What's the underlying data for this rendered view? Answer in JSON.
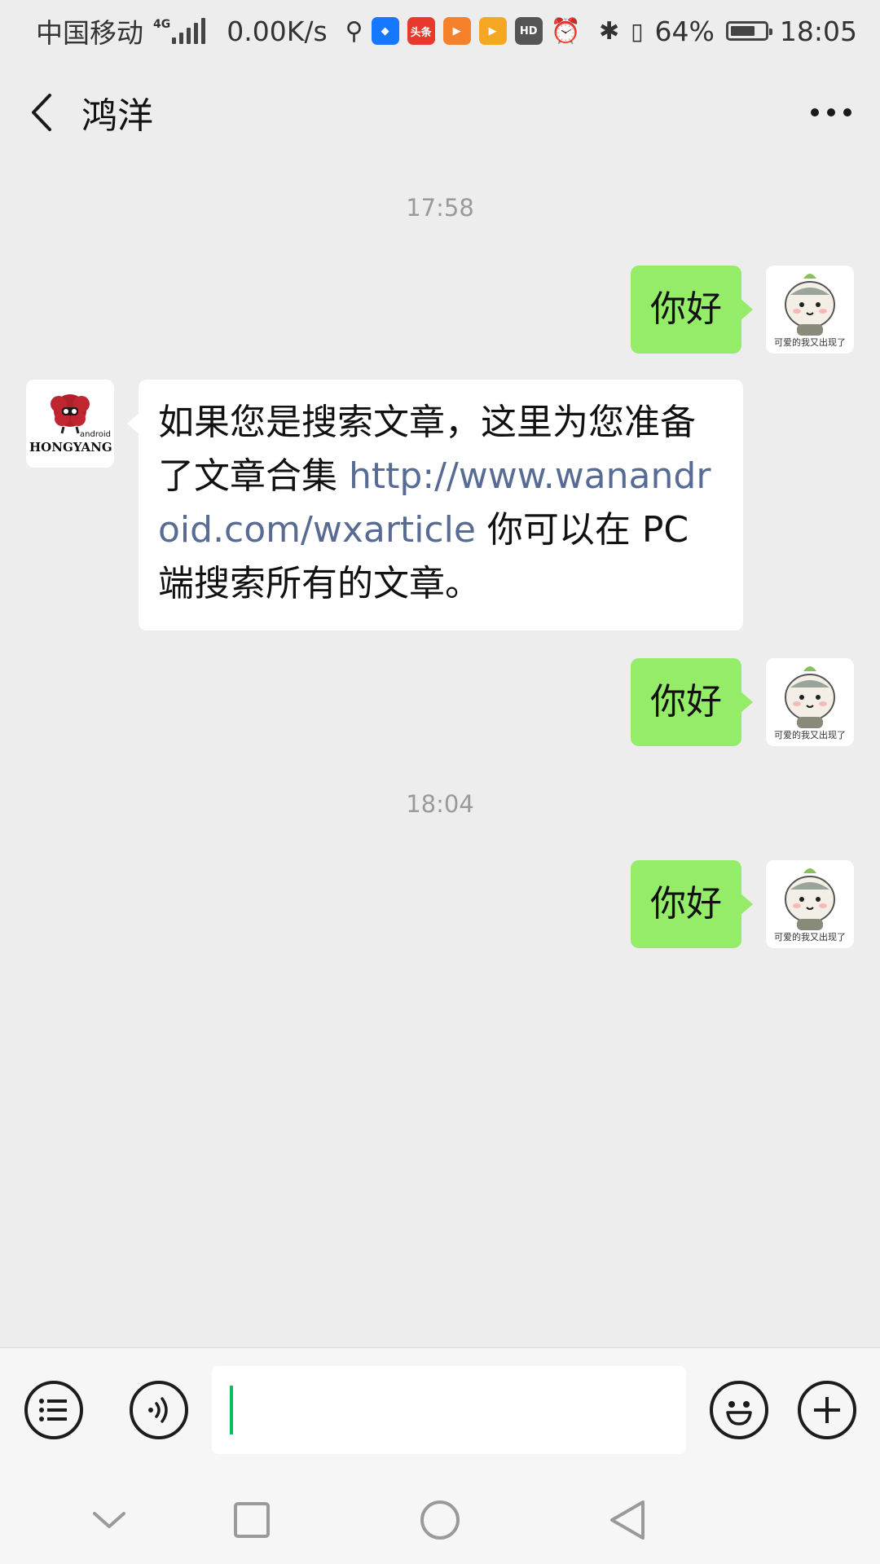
{
  "status_bar": {
    "carrier": "中国移动",
    "network": "4G",
    "speed": "0.00K/s",
    "app_icons": [
      {
        "name": "usb-icon"
      },
      {
        "name": "shield-app-icon",
        "color": "#1677ff"
      },
      {
        "name": "toutiao-app-icon",
        "label": "头条",
        "color": "#e8392f"
      },
      {
        "name": "play-app-icon",
        "color": "#f5822a"
      },
      {
        "name": "video-app-icon",
        "color": "#f5a623"
      },
      {
        "name": "hd-icon",
        "label": "HD"
      },
      {
        "name": "alarm-icon"
      },
      {
        "name": "bluetooth-icon"
      },
      {
        "name": "vibrate-icon"
      }
    ],
    "battery_percent_text": "64%",
    "battery_level": 0.64,
    "time": "18:05"
  },
  "header": {
    "back_icon": "chevron-left-icon",
    "title": "鸿洋",
    "more_icon": "more-dots-icon"
  },
  "messages": [
    {
      "type": "timestamp",
      "text": "17:58"
    },
    {
      "type": "outgoing",
      "text": "你好"
    },
    {
      "type": "incoming",
      "text_parts": [
        "如果您是搜索文章，这里为您准备了文章合集 ",
        "http://www.wanandroid.com/wxarticle",
        " 你可以在 PC 端搜索所有的文章。"
      ]
    },
    {
      "type": "outgoing",
      "text": "你好"
    },
    {
      "type": "timestamp",
      "text": "18:04"
    },
    {
      "type": "outgoing",
      "text": "你好"
    }
  ],
  "avatars": {
    "self_caption": "可爱的我又出现了",
    "other_logo_text": "HONGYANG",
    "other_logo_small": "android"
  },
  "input_bar": {
    "menu_icon": "list-menu-icon",
    "voice_icon": "voice-icon",
    "text_value": "",
    "emoji_icon": "emoji-icon",
    "plus_icon": "plus-icon"
  },
  "nav_bar": {
    "icons": [
      "hide-keyboard-icon",
      "recents-icon",
      "home-icon",
      "back-triangle-icon"
    ]
  },
  "colors": {
    "background": "#ededed",
    "outgoing_bubble": "#95ec69",
    "incoming_bubble": "#ffffff",
    "link": "#576b95",
    "caret": "#07c160"
  }
}
